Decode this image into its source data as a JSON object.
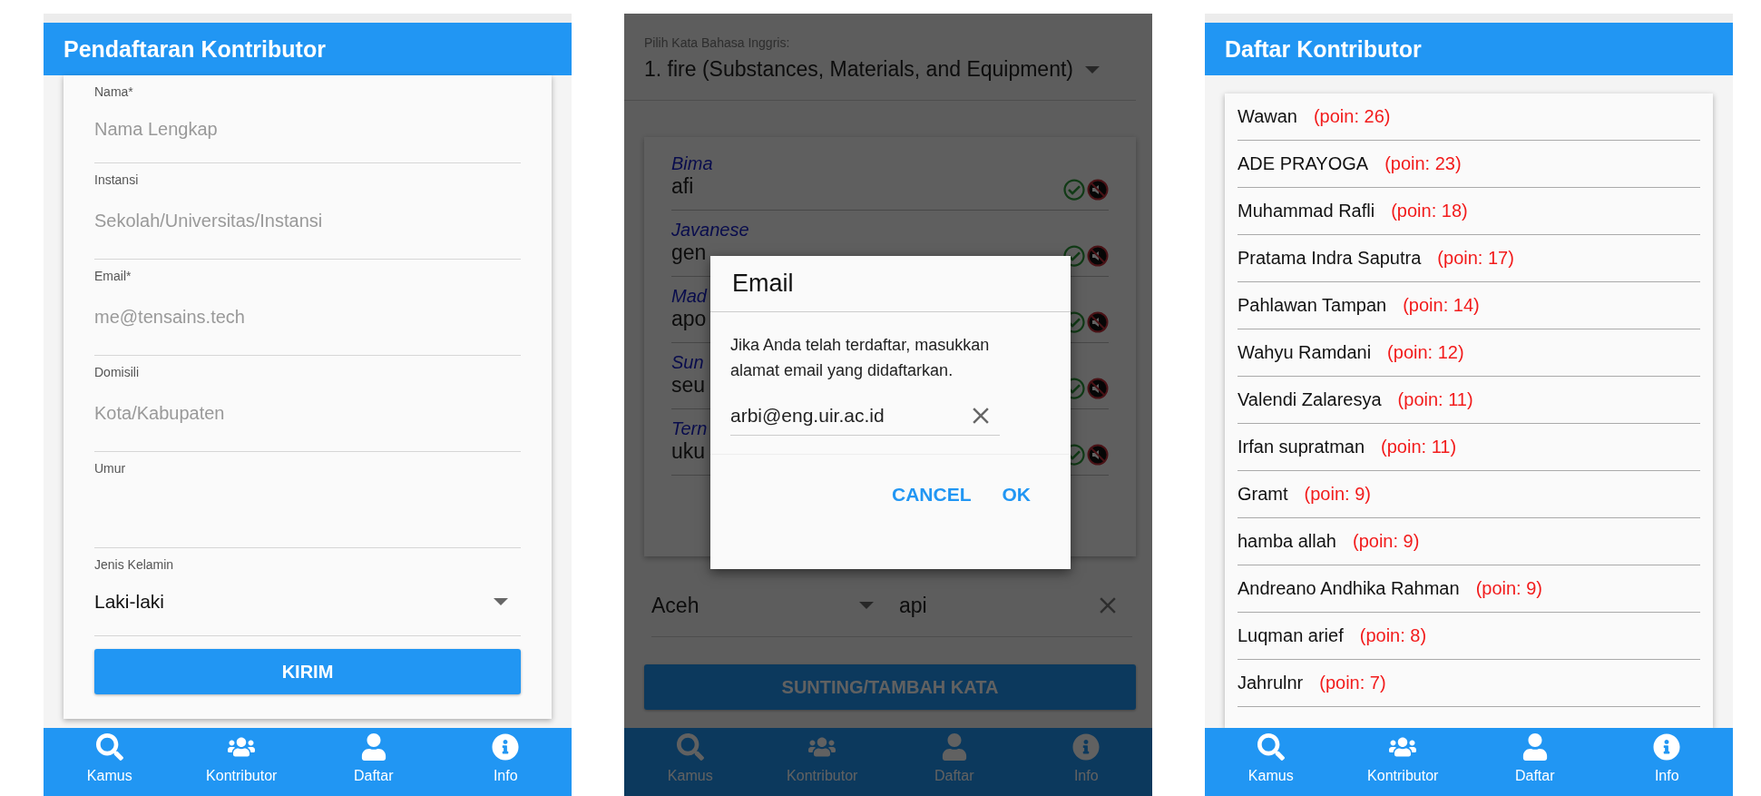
{
  "screens": [
    {
      "kind": "form",
      "title": "Pendaftaran Kontributor",
      "fields": [
        {
          "label": "Nama*",
          "placeholder": "Nama Lengkap"
        },
        {
          "label": "Instansi",
          "placeholder": "Sekolah/Universitas/Instansi"
        },
        {
          "label": "Email*",
          "placeholder": "me@tensains.tech"
        },
        {
          "label": "Domisili",
          "placeholder": "Kota/Kabupaten"
        },
        {
          "label": "Umur"
        }
      ],
      "select": {
        "label": "Jenis Kelamin",
        "value": "Laki-laki"
      },
      "submit": "KIRIM",
      "nav": [
        {
          "label": "Kamus"
        },
        {
          "label": "Kontributor"
        },
        {
          "label": "Daftar"
        },
        {
          "label": "Info"
        }
      ]
    },
    {
      "kind": "editor",
      "word_select": {
        "label": "Pilih Kata Bahasa Inggris:",
        "value": "1.  fire (Substances, Materials, and Equipment)"
      },
      "entries": [
        {
          "language": "Bima",
          "word": "afi"
        },
        {
          "language": "Javanese",
          "word": "gen"
        },
        {
          "language": "Mad",
          "word": "apo"
        },
        {
          "language": "Sun",
          "word": "seu"
        },
        {
          "language": "Tern",
          "word": "uku"
        }
      ],
      "language_select": "Aceh",
      "word_field": "api",
      "submit": "SUNTING/TAMBAH KATA",
      "nav": [
        {
          "label": "Kamus"
        },
        {
          "label": "Kontributor"
        },
        {
          "label": "Daftar"
        },
        {
          "label": "Info"
        }
      ],
      "dialog": {
        "title": "Email",
        "message": "Jika Anda telah terdaftar, masukkan alamat email yang didaftarkan.",
        "value": "arbi@eng.uir.ac.id",
        "buttons": [
          "CANCEL",
          "OK"
        ]
      }
    },
    {
      "kind": "list",
      "title": "Daftar Kontributor",
      "contributors": [
        {
          "name": "Wawan",
          "points": "(poin: 26)"
        },
        {
          "name": "ADE PRAYOGA",
          "points": "(poin: 23)"
        },
        {
          "name": "Muhammad Rafli",
          "points": "(poin: 18)"
        },
        {
          "name": "Pratama Indra Saputra",
          "points": "(poin: 17)"
        },
        {
          "name": "Pahlawan Tampan",
          "points": "(poin: 14)"
        },
        {
          "name": "Wahyu Ramdani",
          "points": "(poin: 12)"
        },
        {
          "name": "Valendi Zalaresya",
          "points": "(poin: 11)"
        },
        {
          "name": "Irfan supratman",
          "points": "(poin: 11)"
        },
        {
          "name": "Gramt",
          "points": "(poin: 9)"
        },
        {
          "name": "hamba allah",
          "points": "(poin: 9)"
        },
        {
          "name": "Andreano Andhika Rahman",
          "points": "(poin: 9)"
        },
        {
          "name": "Luqman arief",
          "points": "(poin: 8)"
        },
        {
          "name": "Jahrulnr",
          "points": "(poin: 7)"
        }
      ],
      "nav": [
        {
          "label": "Kamus"
        },
        {
          "label": "Kontributor"
        },
        {
          "label": "Daftar"
        },
        {
          "label": "Info"
        }
      ]
    }
  ]
}
